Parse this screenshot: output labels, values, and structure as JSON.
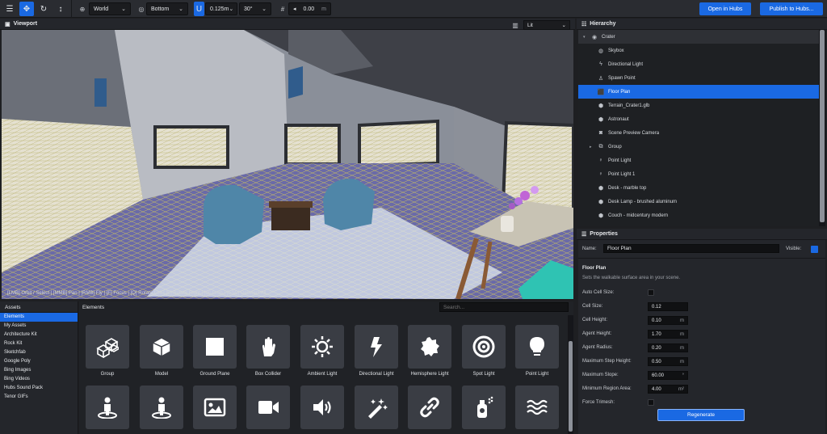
{
  "toolbar": {
    "space_select": "World",
    "pivot_select": "Bottom",
    "snap_translate": "0.125m",
    "snap_rotate": "30°",
    "grid_height": "0.00",
    "grid_unit": "m",
    "open_in_hubs": "Open in Hubs",
    "publish": "Publish to Hubs..."
  },
  "viewport": {
    "title": "Viewport",
    "render_mode": "Lit",
    "controls_hint": "[LMB] Orbit / Select | [MMB] Pan | [RMB] Fly | [F] Focus | [Q] Rotate Left | [E] Rotate Right | [G] Grab | [ESC] Deselect All"
  },
  "assets": {
    "title": "Assets",
    "sources": [
      "Elements",
      "My Assets",
      "Architecture Kit",
      "Rock Kit",
      "Sketchfab",
      "Google Poly",
      "Bing Images",
      "Bing Videos",
      "Hubs Sound Pack",
      "Tenor GIFs"
    ],
    "selected_index": 0,
    "panel_title": "Elements",
    "search_placeholder": "Search...",
    "elements": [
      {
        "label": "Group",
        "icon": "cubes-icon"
      },
      {
        "label": "Model",
        "icon": "cube-icon"
      },
      {
        "label": "Ground Plane",
        "icon": "square-icon"
      },
      {
        "label": "Box Collider",
        "icon": "hand-icon"
      },
      {
        "label": "Ambient Light",
        "icon": "sun-icon"
      },
      {
        "label": "Directional Light",
        "icon": "bolt-icon"
      },
      {
        "label": "Hemisphere Light",
        "icon": "certificate-icon"
      },
      {
        "label": "Spot Light",
        "icon": "bullseye-icon"
      },
      {
        "label": "Point Light",
        "icon": "lightbulb-icon"
      },
      {
        "label": "",
        "icon": "spawn-point-icon"
      },
      {
        "label": "",
        "icon": "spawner-icon"
      },
      {
        "label": "",
        "icon": "image-icon"
      },
      {
        "label": "",
        "icon": "video-icon"
      },
      {
        "label": "",
        "icon": "audio-icon"
      },
      {
        "label": "",
        "icon": "magic-wand-icon"
      },
      {
        "label": "",
        "icon": "link-icon"
      },
      {
        "label": "",
        "icon": "spray-can-icon"
      },
      {
        "label": "",
        "icon": "water-icon"
      }
    ]
  },
  "hierarchy": {
    "title": "Hierarchy",
    "items": [
      {
        "label": "Crater",
        "icon": "scene-icon",
        "depth": 0,
        "expanded": true
      },
      {
        "label": "Skybox",
        "icon": "skybox-icon",
        "depth": 1
      },
      {
        "label": "Directional Light",
        "icon": "bolt-icon",
        "depth": 1
      },
      {
        "label": "Spawn Point",
        "icon": "spawn-point-icon",
        "depth": 1
      },
      {
        "label": "Floor Plan",
        "icon": "floor-plan-icon",
        "depth": 1,
        "selected": true
      },
      {
        "label": "Terrain_Crater1.glb",
        "icon": "model-icon",
        "depth": 1
      },
      {
        "label": "Astronaut",
        "icon": "model-icon",
        "depth": 1
      },
      {
        "label": "Scene Preview Camera",
        "icon": "camera-icon",
        "depth": 1
      },
      {
        "label": "Group",
        "icon": "group-icon",
        "depth": 1,
        "collapsed": true
      },
      {
        "label": "Point Light",
        "icon": "lightbulb-icon",
        "depth": 1
      },
      {
        "label": "Point Light 1",
        "icon": "lightbulb-icon",
        "depth": 1
      },
      {
        "label": "Desk - marble top",
        "icon": "model-icon",
        "depth": 1
      },
      {
        "label": "Desk Lamp - brushed aluminum",
        "icon": "model-icon",
        "depth": 1
      },
      {
        "label": "Couch - midcentury modern",
        "icon": "model-icon",
        "depth": 1
      }
    ]
  },
  "properties": {
    "title": "Properties",
    "name_label": "Name:",
    "name_value": "Floor Plan",
    "visible_label": "Visible:",
    "visible": true,
    "component_title": "Floor Plan",
    "component_desc": "Sets the walkable surface area in your scene.",
    "fields": [
      {
        "label": "Auto Cell Size:",
        "kind": "checkbox",
        "checked": false
      },
      {
        "label": "Cell Size:",
        "kind": "number",
        "value": "0.12",
        "unit": ""
      },
      {
        "label": "Cell Height:",
        "kind": "number",
        "value": "0.10",
        "unit": "m"
      },
      {
        "label": "Agent Height:",
        "kind": "number",
        "value": "1.70",
        "unit": "m"
      },
      {
        "label": "Agent Radius:",
        "kind": "number",
        "value": "0.20",
        "unit": "m"
      },
      {
        "label": "Maximum Step Height:",
        "kind": "number",
        "value": "0.50",
        "unit": "m"
      },
      {
        "label": "Maximum Slope:",
        "kind": "number",
        "value": "60.00",
        "unit": "°"
      },
      {
        "label": "Minimum Region Area:",
        "kind": "number",
        "value": "4.00",
        "unit": "m²"
      },
      {
        "label": "Force Trimesh:",
        "kind": "checkbox",
        "checked": false
      }
    ],
    "regenerate": "Regenerate"
  },
  "colors": {
    "accent": "#1a69e3",
    "panel": "#24262b",
    "background": "#1e1f22"
  }
}
